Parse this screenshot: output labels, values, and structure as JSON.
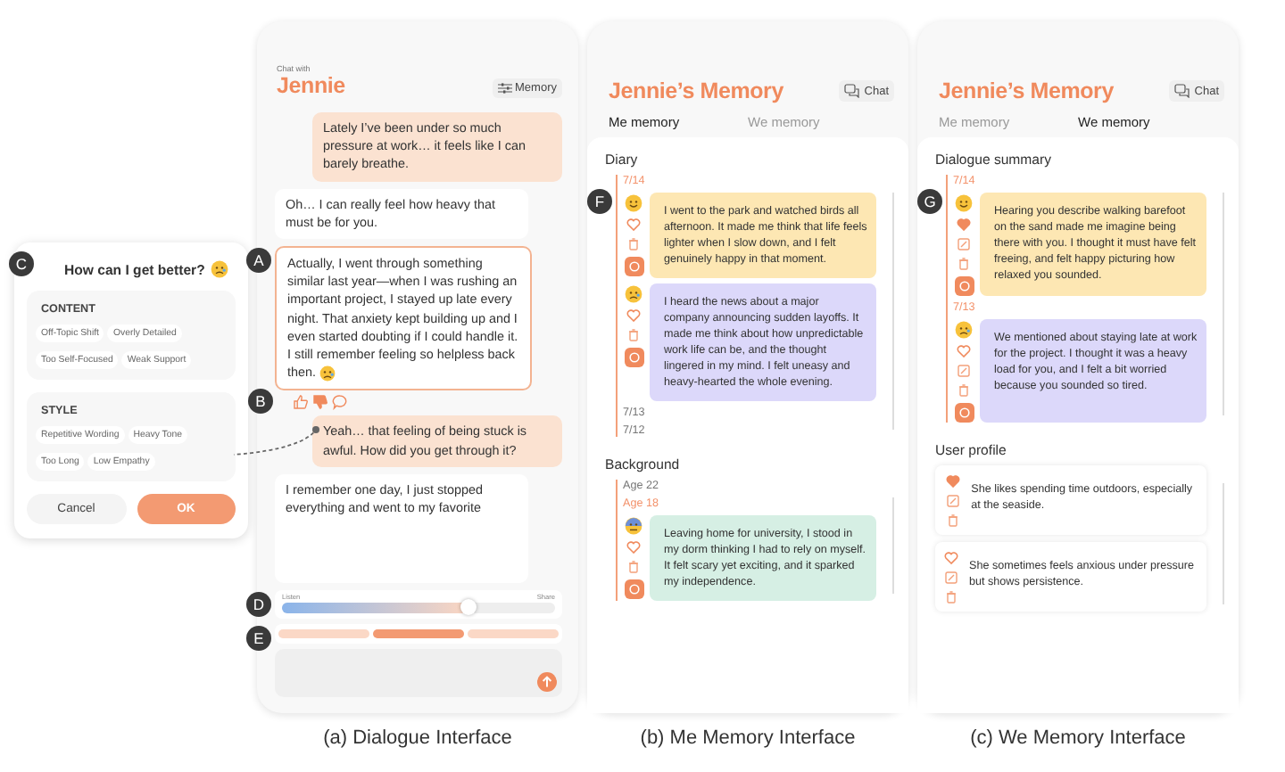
{
  "popup": {
    "badge": "C",
    "title": "How can I get better?",
    "title_emoji": {
      "kind": "sad"
    },
    "groups": [
      {
        "heading": "CONTENT",
        "options": [
          "Off-Topic Shift",
          "Overly Detailed",
          "Too Self-Focused",
          "Weak Support"
        ]
      },
      {
        "heading": "STYLE",
        "options": [
          "Repetitive Wording",
          "Heavy Tone",
          "Too Long",
          "Low Empathy"
        ]
      }
    ],
    "buttons": [
      {
        "label": "Cancel",
        "kind": "secondary"
      },
      {
        "label": "OK",
        "kind": "primary"
      }
    ]
  },
  "dialogue": {
    "subtitle": "Chat with",
    "title": "Jennie",
    "memory_button": "Memory",
    "messages": [
      {
        "kind": "user",
        "text": "Lately I’ve been under so much pressure at work… it feels like I can barely breathe."
      },
      {
        "kind": "bot",
        "text": "Oh… I can really feel how heavy that must be for you."
      },
      {
        "kind": "bot",
        "highlighted": true,
        "badge": "A",
        "emoji": {
          "kind": "sad"
        },
        "text": "Actually, I went through something similar last year—when I was rushing an important project, I stayed up late every night. That anxiety kept building up and I even started doubting if I could handle it. I still remember feeling so helpless back then."
      },
      {
        "kind": "feedback",
        "badge": "B",
        "items": [
          {
            "kind": "like",
            "selected": false
          },
          {
            "kind": "dislike",
            "selected": true
          },
          {
            "kind": "comment",
            "selected": false
          }
        ]
      },
      {
        "kind": "user",
        "text": "Yeah… that feeling of being stuck is awful. How did you get through it?"
      },
      {
        "kind": "bot",
        "text": "I remember one day, I just stopped everything and went to my favorite"
      }
    ],
    "slider": {
      "badge": "D",
      "left_label": "Listen",
      "right_label": "Share",
      "level": 0.68
    },
    "chips": {
      "badge": "E",
      "items": [
        {
          "selected": false
        },
        {
          "selected": true
        },
        {
          "selected": false
        }
      ]
    }
  },
  "memory_views": [
    {
      "title": "Jennie’s Memory",
      "chat_button": "Chat",
      "tabs": [
        {
          "label": "Me memory",
          "selected": true
        },
        {
          "label": "We memory",
          "selected": false
        }
      ],
      "sections": [
        {
          "kind": "timeline",
          "heading": "Diary",
          "nodes": [
            {
              "date": "7/14",
              "selected": true,
              "entries": [
                {
                  "badge": "F",
                  "emoji": {
                    "kind": "happy"
                  },
                  "liked": false,
                  "editable": false,
                  "color": "#fde7b3",
                  "text": "I went to the park and watched birds all afternoon. It made me think that life feels lighter when I slow down, and I felt genuinely happy in that moment."
                },
                {
                  "emoji": {
                    "kind": "sad"
                  },
                  "liked": false,
                  "editable": false,
                  "color": "#dcd8fa",
                  "text": "I heard the news about a major company announcing sudden layoffs. It made me think about how unpredictable work life can be, and the thought lingered in my mind. I felt uneasy and heavy-hearted the whole evening."
                }
              ]
            },
            {
              "date": "7/13",
              "selected": false
            },
            {
              "date": "7/12",
              "selected": false
            }
          ]
        },
        {
          "kind": "timeline",
          "heading": "Background",
          "nodes": [
            {
              "date": "Age 22",
              "selected": false
            },
            {
              "date": "Age 18",
              "selected": true,
              "entries": [
                {
                  "emoji": {
                    "kind": "nervous"
                  },
                  "liked": false,
                  "editable": false,
                  "color": "#d6efe4",
                  "text": "Leaving home for university, I stood in my dorm thinking I had to rely on myself. It felt scary yet exciting, and it sparked my independence."
                }
              ]
            }
          ]
        }
      ],
      "caption": "(b) Me Memory Interface"
    },
    {
      "title": "Jennie’s Memory",
      "chat_button": "Chat",
      "tabs": [
        {
          "label": "Me memory",
          "selected": false
        },
        {
          "label": "We memory",
          "selected": true
        }
      ],
      "sections": [
        {
          "kind": "timeline",
          "heading": "Dialogue summary",
          "nodes": [
            {
              "date": "7/14",
              "selected": true,
              "entries": [
                {
                  "badge": "G",
                  "emoji": {
                    "kind": "happy"
                  },
                  "liked": true,
                  "editable": true,
                  "color": "#fde7b3",
                  "text": "Hearing you describe walking barefoot on the sand made me imagine being there with you. I thought it must have felt freeing, and felt happy picturing how relaxed you sounded."
                }
              ]
            },
            {
              "date": "7/13",
              "selected": true,
              "entries": [
                {
                  "emoji": {
                    "kind": "sad"
                  },
                  "liked": false,
                  "editable": true,
                  "color": "#dcd8fa",
                  "text": "We mentioned about staying late at work for the project. I thought it was a heavy load for you, and I felt a bit worried because you sounded so tired."
                }
              ]
            }
          ]
        },
        {
          "kind": "list",
          "heading": "User profile",
          "entries": [
            {
              "liked": true,
              "editable": true,
              "text": "She likes spending time outdoors, especially at the seaside."
            },
            {
              "liked": false,
              "editable": true,
              "text": "She sometimes feels anxious under pressure but shows persistence."
            }
          ]
        }
      ],
      "caption": "(c) We Memory Interface"
    }
  ],
  "dialogue_caption": "(a) Dialogue Interface"
}
